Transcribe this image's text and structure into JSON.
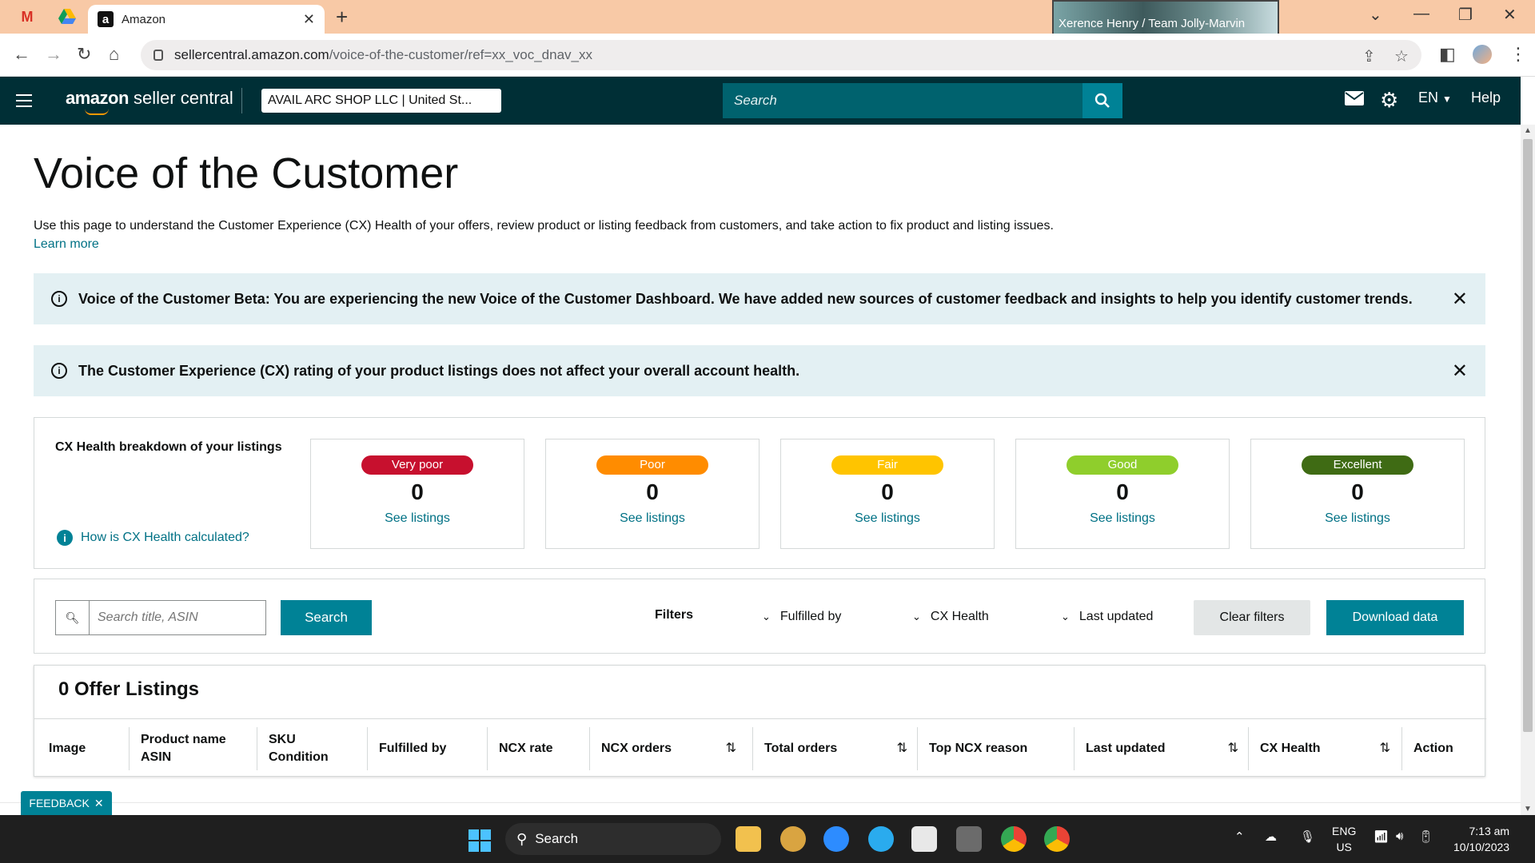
{
  "browser": {
    "tab_title": "Amazon",
    "tab_close": "✕",
    "new_tab": "+",
    "video_label": "Xerence Henry / Team Jolly-Marvin",
    "url_domain": "sellercentral.amazon.com",
    "url_path": "/voice-of-the-customer/ref=xx_voc_dnav_xx"
  },
  "header": {
    "logo_brand": "amazon",
    "logo_suffix": "seller central",
    "store": "AVAIL ARC SHOP LLC | United St...",
    "search_placeholder": "Search",
    "language": "EN",
    "help": "Help"
  },
  "page": {
    "title": "Voice of the Customer",
    "description": "Use this page to understand the Customer Experience (CX) Health of your offers, review product or listing feedback from customers, and take action to fix product and listing issues.",
    "learn_more": "Learn more"
  },
  "alerts": [
    {
      "text": "Voice of the Customer Beta: You are experiencing the new Voice of the Customer Dashboard. We have added new sources of customer feedback and insights to help you identify customer trends."
    },
    {
      "text": "The Customer Experience (CX) rating of your product listings does not affect your overall account health."
    }
  ],
  "breakdown": {
    "title": "CX Health breakdown of your listings",
    "calc_link": "How is CX Health calculated?",
    "ratings": [
      {
        "label": "Very poor",
        "count": "0",
        "link": "See listings",
        "color": "#c7102e",
        "text_color": "#ffffff"
      },
      {
        "label": "Poor",
        "count": "0",
        "link": "See listings",
        "color": "#ff8c00",
        "text_color": "#ffffff"
      },
      {
        "label": "Fair",
        "count": "0",
        "link": "See listings",
        "color": "#ffc400",
        "text_color": "#ffffff"
      },
      {
        "label": "Good",
        "count": "0",
        "link": "See listings",
        "color": "#8fce2c",
        "text_color": "#ffffff"
      },
      {
        "label": "Excellent",
        "count": "0",
        "link": "See listings",
        "color": "#3f6b14",
        "text_color": "#ffffff"
      }
    ]
  },
  "filterbar": {
    "search_placeholder": "Search title, ASIN",
    "search_button": "Search",
    "filters_label": "Filters",
    "dropdowns": [
      "Fulfilled by",
      "CX Health",
      "Last updated"
    ],
    "clear_button": "Clear filters",
    "download_button": "Download data"
  },
  "listings": {
    "title": "0 Offer Listings",
    "columns": [
      {
        "line1": "Image",
        "line2": ""
      },
      {
        "line1": "Product name",
        "line2": "ASIN"
      },
      {
        "line1": "SKU",
        "line2": "Condition"
      },
      {
        "line1": "Fulfilled by",
        "line2": ""
      },
      {
        "line1": "NCX rate",
        "line2": ""
      },
      {
        "line1": "NCX orders",
        "line2": ""
      },
      {
        "line1": "Total orders",
        "line2": ""
      },
      {
        "line1": "Top NCX reason",
        "line2": ""
      },
      {
        "line1": "Last updated",
        "line2": ""
      },
      {
        "line1": "CX Health",
        "line2": ""
      },
      {
        "line1": "Action",
        "line2": ""
      }
    ]
  },
  "feedback_tab": "FEEDBACK",
  "taskbar": {
    "search": "Search",
    "lang_line1": "ENG",
    "lang_line2": "US",
    "time": "7:13 am",
    "date": "10/10/2023"
  },
  "colors": {
    "header_bg": "#002f36",
    "accent_teal": "#008296",
    "link": "#007185",
    "alert_bg": "#e3f0f3"
  }
}
